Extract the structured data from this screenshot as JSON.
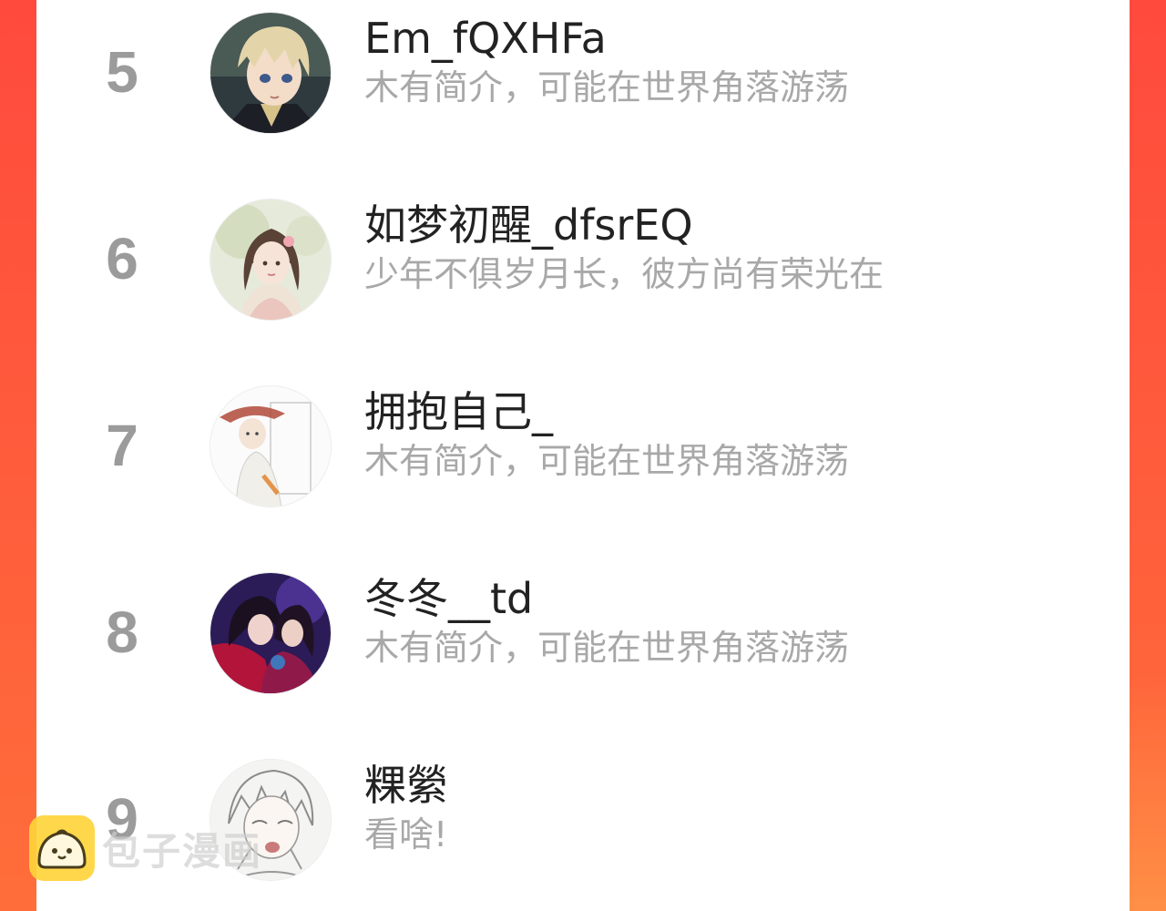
{
  "colors": {
    "frame_accent": "#ff5a3c",
    "rank_gray": "#9b9b9b",
    "username_text": "#222222",
    "bio_text": "#a8a8a8",
    "logo_yellow": "#ffd43b"
  },
  "entries": [
    {
      "rank": "5",
      "username": "Em_fQXHFa",
      "bio": "木有简介，可能在世界角落游荡",
      "avatar": "anime-blond-boy-avatar"
    },
    {
      "rank": "6",
      "username": "如梦初醒_dfsrEQ",
      "bio": "少年不俱岁月长，彼方尚有荣光在",
      "avatar": "ancient-style-girl-avatar"
    },
    {
      "rank": "7",
      "username": "拥抱自己_",
      "bio": "木有简介，可能在世界角落游荡",
      "avatar": "sketch-figure-hat-avatar"
    },
    {
      "rank": "8",
      "username": "冬冬__td",
      "bio": "木有简介，可能在世界角落游荡",
      "avatar": "couple-purple-red-avatar"
    },
    {
      "rank": "9",
      "username": "粿縈",
      "bio": "看啥!",
      "avatar": "lineart-boy-avatar"
    }
  ],
  "watermark": {
    "text": "包子漫画",
    "icon": "bun-logo-icon"
  }
}
